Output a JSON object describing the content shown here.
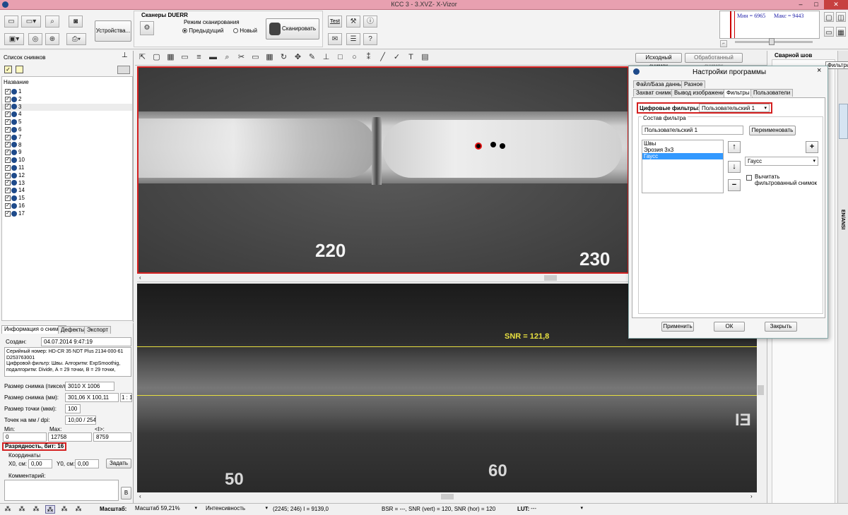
{
  "window": {
    "title": "КСС 3 - 3.XVZ- X-Vizor",
    "minimize": "–",
    "maximize": "□",
    "close": "✕"
  },
  "ribbon": {
    "devices_label": "Устройства...",
    "scanners_title": "Сканеры DUERR",
    "scan_mode_label": "Режим сканирования",
    "mode_previous": "Предыдущий",
    "mode_new": "Новый",
    "scan_button": "Сканировать",
    "test_label": "Test"
  },
  "histogram": {
    "min_label": "Мин = 6965",
    "max_label": "Макс = 9443"
  },
  "right_panel": {
    "title": "Сварной шов",
    "tooltip": "Фильтры",
    "side_tab": "EN/ANSI"
  },
  "image_list": {
    "title": "Список снимков",
    "column_name": "Название",
    "items": [
      "1",
      "2",
      "3",
      "4",
      "5",
      "6",
      "7",
      "8",
      "9",
      "10",
      "11",
      "12",
      "13",
      "14",
      "15",
      "16",
      "17"
    ],
    "selected_index": 2
  },
  "info_tabs": [
    "Информация о снимке",
    "Дефекты",
    "Экспорт"
  ],
  "info": {
    "created_label": "Создан:",
    "created_value": "04.07.2014 9:47:19",
    "description": "Серийный номер: HD-CR 35 NDT Plus 2134-000-61 D253763001\nЦифровой фильтр: Швы. Алгоритм: ExpSmoothig, подалгоритм: Divide, А = 29 точки, В = 29 точки,",
    "size_px_label": "Размер снимка (пиксели):",
    "size_px_value": "3010 X 1006",
    "size_mm_label": "Размер снимка (мм):",
    "size_mm_value": "301,06 X 100,11",
    "scale_value": "1 : 1",
    "pixel_size_label": "Размер точки (мкм):",
    "pixel_size_value": "100",
    "dpi_label": "Точек на мм / dpi:",
    "dpi_value": "10,00 / 254",
    "min_label": "Min:",
    "max_label": "Max:",
    "avg_label": "<I>:",
    "min_value": "0",
    "max_value": "12758",
    "avg_value": "8759",
    "bitdepth_label": "Разрядность, бит: 16",
    "coords_label": "Координаты",
    "x0_label": "X0, см:",
    "x0_value": "0,00",
    "y0_label": "Y0, см:",
    "y0_value": "0,00",
    "set_button": "Задать",
    "comment_label": "Комментарий:",
    "comment_button": "В"
  },
  "image_toolbar": {
    "original_button": "Исходный снимок",
    "processed_button": "Обработанный снимок"
  },
  "viewer": {
    "top_marks": [
      "220",
      "230"
    ],
    "bottom_marks": [
      "50",
      "60"
    ],
    "snr_label": "SNR = 121,8",
    "bottom_side_mark": "EI"
  },
  "dialog": {
    "title": "Настройки программы",
    "tabs_row1": [
      "Файл/База данных",
      "Разное"
    ],
    "tabs_row2": [
      "Захват снимка",
      "Вывод изображения",
      "Фильтры",
      "Пользователи"
    ],
    "digital_filters_label": "Цифровые фильтры:",
    "digital_filters_value": "Пользовательский 1",
    "composition_label": "Состав фильтра",
    "filter_name_value": "Пользовательский 1",
    "rename_button": "Переименовать",
    "filter_items": [
      "Швы",
      "Эрозия 3x3",
      "Гаусс"
    ],
    "filter_selected": 2,
    "add_select_value": "Гаусс",
    "subtract_label": "Вычитать фильтрованный снимок",
    "apply_button": "Применить",
    "ok_button": "ОК",
    "close_button": "Закрыть"
  },
  "status": {
    "scale_label": "Масштаб:",
    "scale_value": "Масштаб 59,21%",
    "mode_value": "Интенсивность",
    "coords_value": "(2245; 246) I = 9139,0",
    "snr_value": "BSR = ---, SNR (vert) = 120, SNR (hor) = 120",
    "lut_label": "LUT:",
    "lut_value": "---"
  },
  "colors": {
    "accent_red": "#d42020",
    "yellow_line": "#e8e040",
    "selection_blue": "#3399ff"
  }
}
